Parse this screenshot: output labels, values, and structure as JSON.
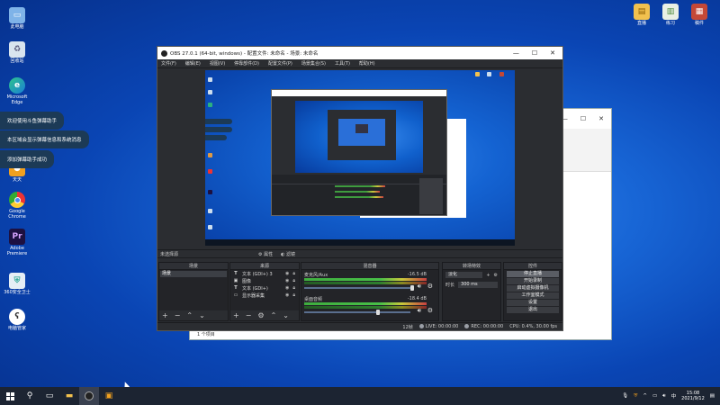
{
  "desktop": {
    "icons": [
      {
        "label": "此电脑",
        "icon": "computer-icon"
      },
      {
        "label": "回收站",
        "icon": "recycle-bin-icon"
      },
      {
        "label": "Microsoft Edge",
        "icon": "edge-icon"
      },
      {
        "label": "天天",
        "icon": "app-icon"
      },
      {
        "label": "Google Chrome",
        "icon": "chrome-icon"
      },
      {
        "label": "Adobe Premiere",
        "icon": "premiere-icon"
      },
      {
        "label": "360安全卫士",
        "icon": "shield-icon"
      },
      {
        "label": "电脑管家",
        "icon": "bear-icon"
      }
    ],
    "right_icons": [
      {
        "label": "直播",
        "icon": "folder-icon"
      },
      {
        "label": "练习",
        "icon": "file-icon"
      },
      {
        "label": "稿件",
        "icon": "doc-icon"
      }
    ],
    "toasts": [
      "欢迎使用斗鱼弹幕助手",
      "本区域会显示弹幕信息和系统消息",
      "添加弹幕助手成功"
    ]
  },
  "background_window": {
    "controls": [
      "—",
      "☐",
      "✕"
    ],
    "status": "1 个项目"
  },
  "obs": {
    "title": "OBS 27.0.1 (64-bit, windows) - 配置文件: 未命名 - 场景: 未命名",
    "window_controls": [
      "—",
      "☐",
      "✕"
    ],
    "menu": [
      "文件(F)",
      "编辑(E)",
      "视图(V)",
      "停靠部件(D)",
      "配置文件(P)",
      "场景集合(S)",
      "工具(T)",
      "帮助(H)"
    ],
    "subbar": {
      "left": "未选择源",
      "props": "属性",
      "filters": "滤镜"
    },
    "scenes": {
      "header": "场景",
      "items": [
        "场景"
      ]
    },
    "sources": {
      "header": "来源",
      "items": [
        {
          "type": "T",
          "name": "文本 (GDI+) 3"
        },
        {
          "type": "▣",
          "name": "图像"
        },
        {
          "type": "T",
          "name": "文本 (GDI+)"
        },
        {
          "type": "▭",
          "name": "显示器采集"
        }
      ]
    },
    "mixer": {
      "header": "混音器",
      "channels": [
        {
          "name": "麦克风/Aux",
          "db": "-16.5 dB",
          "level": 0.78
        },
        {
          "name": "桌面音频",
          "db": "-18.4 dB",
          "level": 0.72
        }
      ]
    },
    "transitions": {
      "header": "转场特效",
      "type": "淡化",
      "duration_label": "时长",
      "duration": "300 ms"
    },
    "controls": {
      "header": "控件",
      "buttons": [
        "停止直播",
        "开始录制",
        "启动虚拟摄像机",
        "工作室模式",
        "设置",
        "退出"
      ]
    },
    "status": {
      "fps_label": "LIVE: 00:00:00",
      "rec": "REC: 00:00:00",
      "cpu": "CPU: 0.4%, 30.00 fps",
      "dropped": "12帧"
    }
  },
  "taskbar": {
    "time": "15:08",
    "date": "2021/9/12"
  },
  "colors": {
    "accent": "#1866d6",
    "obs_bg": "#2b2d31",
    "taskbar": "#1c2432"
  }
}
